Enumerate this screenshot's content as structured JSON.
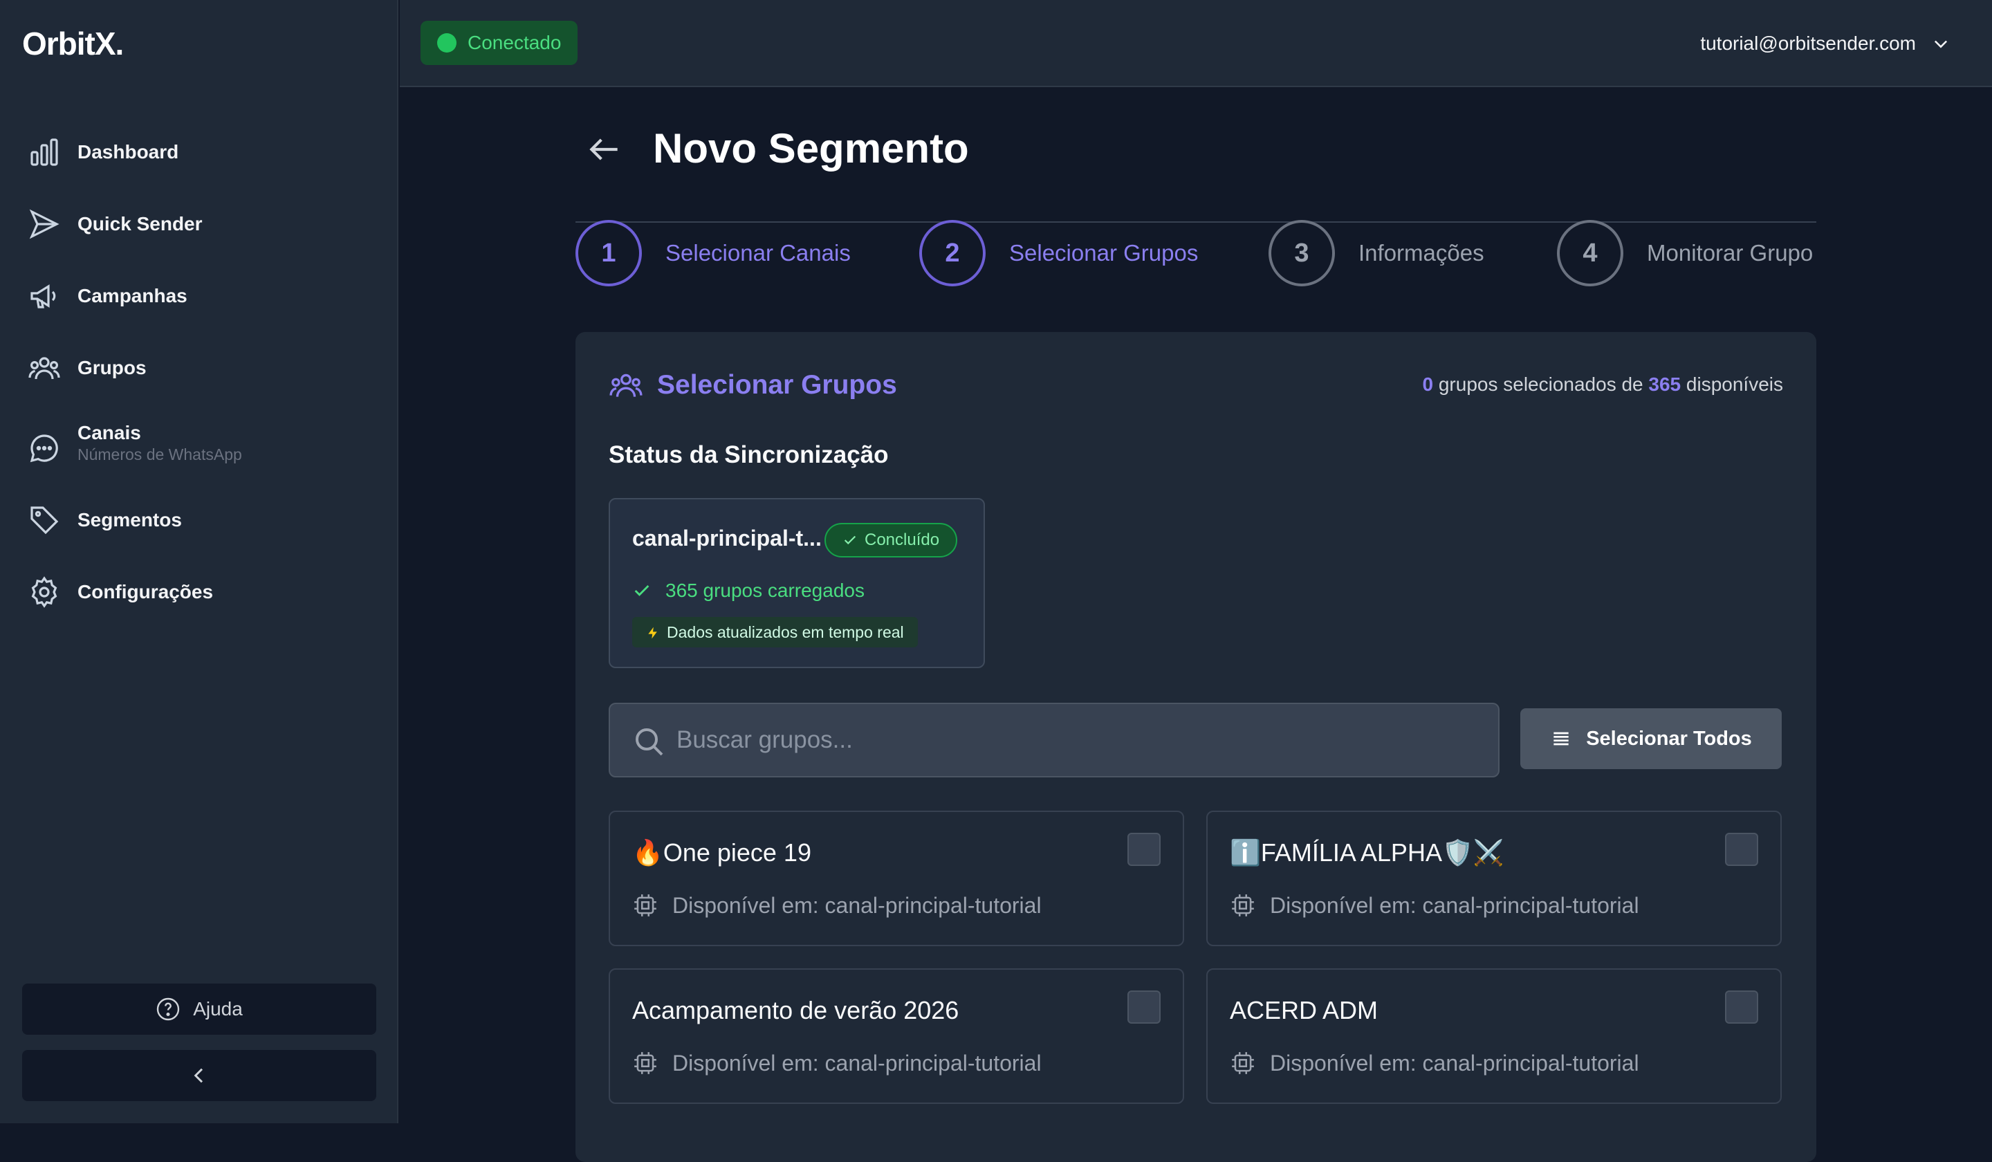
{
  "app": {
    "logo": "OrbitX."
  },
  "sidebar": {
    "items": [
      {
        "label": "Dashboard",
        "icon": "bar-chart-icon"
      },
      {
        "label": "Quick Sender",
        "icon": "send-icon"
      },
      {
        "label": "Campanhas",
        "icon": "megaphone-icon"
      },
      {
        "label": "Grupos",
        "icon": "users-icon"
      },
      {
        "label": "Canais",
        "sublabel": "Números de WhatsApp",
        "icon": "chat-icon"
      },
      {
        "label": "Segmentos",
        "icon": "tag-icon"
      },
      {
        "label": "Configurações",
        "icon": "gear-icon"
      }
    ],
    "help_label": "Ajuda"
  },
  "topbar": {
    "status": "Conectado",
    "user_email": "tutorial@orbitsender.com"
  },
  "page": {
    "title": "Novo Segmento",
    "steps": [
      {
        "number": "1",
        "label": "Selecionar Canais",
        "active": true
      },
      {
        "number": "2",
        "label": "Selecionar Grupos",
        "active": true
      },
      {
        "number": "3",
        "label": "Informações",
        "active": false
      },
      {
        "number": "4",
        "label": "Monitorar Grupo",
        "active": false
      }
    ]
  },
  "groups_panel": {
    "title": "Selecionar Grupos",
    "selected_count": "0",
    "counter_mid": "grupos selecionados de",
    "available_count": "365",
    "counter_end": "disponíveis",
    "sync_title": "Status da Sincronização",
    "sync": {
      "channel": "canal-principal-t...",
      "status": "Concluído",
      "loaded": "365 grupos carregados",
      "live": "Dados atualizados em tempo real"
    },
    "search_placeholder": "Buscar grupos...",
    "select_all_label": "Selecionar Todos",
    "groups": [
      {
        "name": "🔥One piece 19",
        "available": "Disponível em: canal-principal-tutorial"
      },
      {
        "name": "ℹ️FAMÍLIA ALPHA🛡️⚔️",
        "available": "Disponível em: canal-principal-tutorial"
      },
      {
        "name": "Acampamento de verão 2026",
        "available": "Disponível em: canal-principal-tutorial"
      },
      {
        "name": "ACERD ADM",
        "available": "Disponível em: canal-principal-tutorial"
      }
    ]
  },
  "colors": {
    "accent": "#8b7ff0",
    "success": "#22c55e",
    "background": "#111827",
    "surface": "#1f2937"
  }
}
